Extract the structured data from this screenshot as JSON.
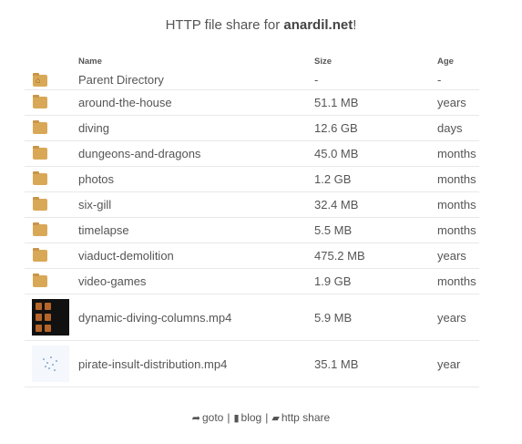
{
  "header": {
    "prefix": "HTTP file share for ",
    "host": "anardil.net",
    "suffix": "!"
  },
  "columns": {
    "name": "Name",
    "size": "Size",
    "age": "Age"
  },
  "parent": {
    "name": "Parent Directory",
    "size": "-",
    "age": "-",
    "icon": "home-folder-icon"
  },
  "folders": [
    {
      "name": "around-the-house",
      "size": "51.1 MB",
      "age": "years",
      "icon": "folder-icon"
    },
    {
      "name": "diving",
      "size": "12.6 GB",
      "age": "days",
      "icon": "folder-icon"
    },
    {
      "name": "dungeons-and-dragons",
      "size": "45.0 MB",
      "age": "months",
      "icon": "folder-icon"
    },
    {
      "name": "photos",
      "size": "1.2 GB",
      "age": "months",
      "icon": "folder-icon"
    },
    {
      "name": "six-gill",
      "size": "32.4 MB",
      "age": "months",
      "icon": "folder-icon"
    },
    {
      "name": "timelapse",
      "size": "5.5 MB",
      "age": "months",
      "icon": "folder-icon"
    },
    {
      "name": "viaduct-demolition",
      "size": "475.2 MB",
      "age": "years",
      "icon": "folder-icon"
    },
    {
      "name": "video-games",
      "size": "1.9 GB",
      "age": "months",
      "icon": "folder-icon"
    }
  ],
  "files": [
    {
      "name": "dynamic-diving-columns.mp4",
      "size": "5.9 MB",
      "age": "years",
      "icon": "video-thumbnail"
    },
    {
      "name": "pirate-insult-distribution.mp4",
      "size": "35.1 MB",
      "age": "year",
      "icon": "video-thumbnail"
    }
  ],
  "footer": {
    "goto": "goto",
    "sep": "|",
    "blog": "blog",
    "share": "http share"
  },
  "colors": {
    "folder": "#d9a857",
    "text": "#555555",
    "divider": "#e8e8e8"
  }
}
